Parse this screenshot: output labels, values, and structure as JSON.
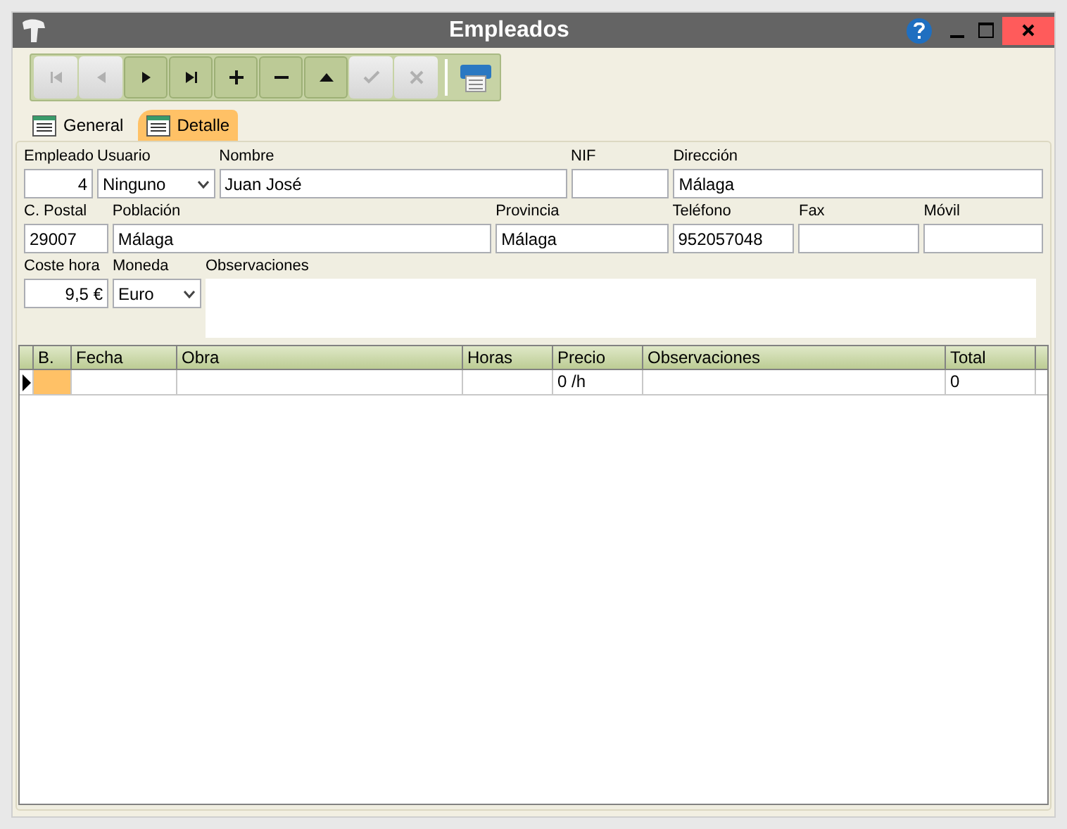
{
  "window": {
    "title": "Empleados"
  },
  "toolbar": [
    {
      "kind": "first",
      "disabled": true
    },
    {
      "kind": "prev",
      "disabled": true
    },
    {
      "kind": "next",
      "disabled": false
    },
    {
      "kind": "last",
      "disabled": false
    },
    {
      "kind": "add",
      "disabled": false
    },
    {
      "kind": "remove",
      "disabled": false
    },
    {
      "kind": "up",
      "disabled": false
    },
    {
      "kind": "confirm",
      "disabled": true
    },
    {
      "kind": "cancel",
      "disabled": true
    }
  ],
  "tabs": [
    {
      "label": "General",
      "selected": false
    },
    {
      "label": "Detalle",
      "selected": true
    }
  ],
  "form_rows": [
    [
      {
        "label": "Empleado",
        "value": "4",
        "kind": "number"
      },
      {
        "label": "Usuario",
        "value": "Ninguno",
        "kind": "select"
      },
      {
        "label": "Nombre",
        "value": "Juan José",
        "kind": "text"
      },
      {
        "label": "NIF",
        "kind": "text"
      },
      {
        "label": "Dirección",
        "value": "Málaga",
        "kind": "text"
      }
    ],
    [
      {
        "label": "C. Postal",
        "value": "29007",
        "kind": "text"
      },
      {
        "label": "Población",
        "value": "Málaga",
        "kind": "text"
      },
      {
        "label": "Provincia",
        "value": "Málaga",
        "kind": "text"
      },
      {
        "label": "Teléfono",
        "value": "952057048",
        "kind": "text"
      },
      {
        "label": "Fax",
        "kind": "text"
      },
      {
        "label": "Móvil",
        "kind": "text"
      }
    ],
    [
      {
        "label": "Coste hora",
        "value": "9,5 €",
        "kind": "number"
      },
      {
        "label": "Moneda",
        "value": "Euro",
        "kind": "select"
      },
      {
        "label": "Observaciones",
        "kind": "memo"
      }
    ]
  ],
  "table": {
    "columns": [
      "B.",
      "Fecha",
      "Obra",
      "Horas",
      "Precio",
      "Observaciones",
      "Total"
    ],
    "rows": [
      {
        "cells": [
          "",
          "",
          "",
          "",
          "0 /h",
          "",
          "0"
        ],
        "selected": true
      }
    ]
  }
}
